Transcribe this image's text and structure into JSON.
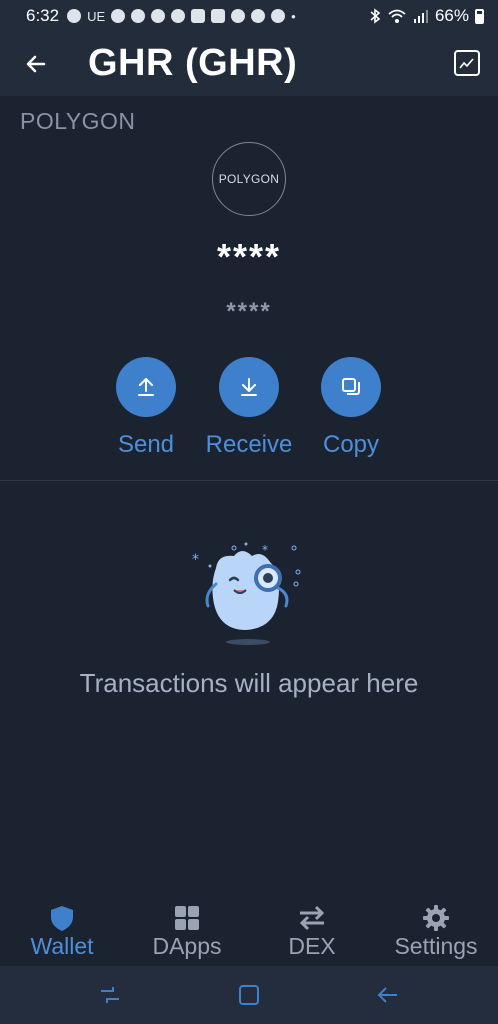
{
  "status_bar": {
    "time": "6:32",
    "carrier_text": "UE",
    "battery": "66%"
  },
  "header": {
    "title": "GHR (GHR)",
    "back_icon": "arrow-left-icon",
    "chart_icon": "line-chart-icon"
  },
  "token": {
    "network": "POLYGON",
    "logo_text": "POLYGON",
    "balance": "****",
    "fiat_balance": "****"
  },
  "actions": [
    {
      "label": "Send",
      "icon": "upload-arrow-icon"
    },
    {
      "label": "Receive",
      "icon": "download-arrow-icon"
    },
    {
      "label": "Copy",
      "icon": "copy-icon"
    }
  ],
  "empty_state": {
    "message": "Transactions will appear here"
  },
  "bottom_nav": [
    {
      "label": "Wallet",
      "icon": "shield-icon",
      "active": true
    },
    {
      "label": "DApps",
      "icon": "grid-icon",
      "active": false
    },
    {
      "label": "DEX",
      "icon": "swap-icon",
      "active": false
    },
    {
      "label": "Settings",
      "icon": "gear-icon",
      "active": false
    }
  ],
  "colors": {
    "background": "#1b2230",
    "header": "#232c3b",
    "accent": "#3f80cc",
    "accent_text": "#4f8fd9",
    "muted_text": "#8a93a3"
  }
}
